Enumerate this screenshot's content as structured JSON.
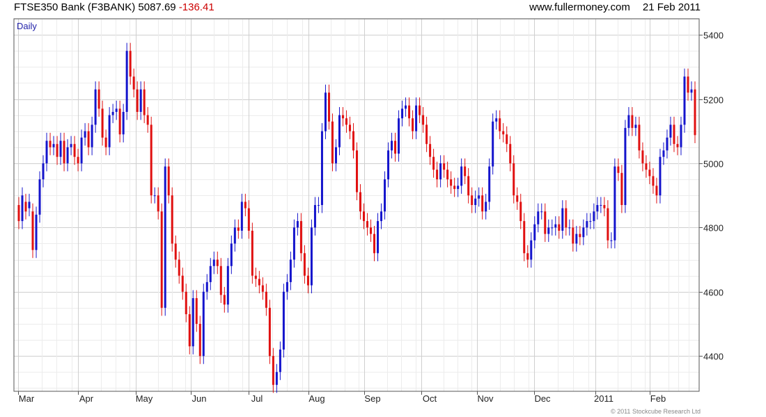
{
  "header": {
    "instrument": "FTSE350 Bank (F3BANK)",
    "last_price": "5087.69",
    "change": "-136.41",
    "source": "www.fullermoney.com",
    "date": "21 Feb 2011"
  },
  "footer": {
    "copyright": "© 2011 Stockcube Research Ltd"
  },
  "colors": {
    "up": "#1414cc",
    "down": "#e01010",
    "change": "#cc0000",
    "grid": "#d4d4d4",
    "label_blue": "#2222aa"
  },
  "chart_data": {
    "type": "ohlc",
    "period_label": "Daily",
    "x_tick_labels": [
      "Mar",
      "Apr",
      "May",
      "Jun",
      "Jul",
      "Aug",
      "Sep",
      "Oct",
      "Nov",
      "Dec",
      "2011",
      "Feb"
    ],
    "y_tick_labels": [
      "4400",
      "4600",
      "4800",
      "5000",
      "5200",
      "5400"
    ],
    "ylim": [
      4290,
      5450
    ],
    "grid": true,
    "series": [
      {
        "values": [
          4820,
          4900,
          4850,
          4880,
          4730,
          4840,
          4950,
          5000,
          5070,
          5050,
          5060,
          5020,
          5070,
          5000,
          5050,
          5060,
          5020,
          5000,
          5080,
          5100,
          5050,
          5120,
          5230,
          5170,
          5080,
          5050,
          5150,
          5160,
          5170,
          5090,
          5160,
          5350,
          5270,
          5230,
          5160,
          5230,
          5150,
          5120,
          4900,
          4900,
          4850,
          4550,
          4990,
          4900,
          4750,
          4700,
          4650,
          4600,
          4530,
          4430,
          4580,
          4500,
          4400,
          4600,
          4630,
          4680,
          4700,
          4680,
          4590,
          4560,
          4680,
          4750,
          4800,
          4790,
          4880,
          4860,
          4790,
          4650,
          4640,
          4620,
          4600,
          4550,
          4400,
          4310,
          4350,
          4420,
          4600,
          4630,
          4700,
          4800,
          4820,
          4720,
          4650,
          4620,
          4800,
          4870,
          4870,
          5100,
          5220,
          5130,
          5000,
          5050,
          5150,
          5140,
          5120,
          5100,
          5040,
          4910,
          4850,
          4820,
          4800,
          4780,
          4720,
          4820,
          4850,
          4950,
          5040,
          5070,
          5030,
          5140,
          5170,
          5180,
          5140,
          5100,
          5180,
          5150,
          5120,
          5060,
          5020,
          4980,
          4950,
          5000,
          4980,
          4950,
          4930,
          4920,
          4930,
          4990,
          4960,
          4900,
          4870,
          4890,
          4900,
          4850,
          4880,
          4990,
          5130,
          5140,
          5100,
          5090,
          5060,
          5000,
          4900,
          4880,
          4820,
          4720,
          4700,
          4760,
          4810,
          4850,
          4850,
          4780,
          4800,
          4800,
          4810,
          4790,
          4860,
          4800,
          4800,
          4750,
          4780,
          4770,
          4800,
          4820,
          4820,
          4850,
          4870,
          4870,
          4860,
          4760,
          4760,
          4990,
          4970,
          4870,
          5110,
          5150,
          5110,
          5120,
          5040,
          5000,
          4980,
          4960,
          4930,
          4900,
          5020,
          5040,
          5080,
          5120,
          5060,
          5050,
          5120,
          5270,
          5220,
          5230,
          5087.69
        ]
      },
      {
        "values": [
          4870,
          4820,
          4880,
          4860,
          4850,
          4730,
          4840,
          4950,
          5000,
          5070,
          5050,
          5060,
          5020,
          5070,
          5000,
          5050,
          5060,
          5020,
          5000,
          5080,
          5100,
          5050,
          5120,
          5230,
          5170,
          5080,
          5050,
          5150,
          5160,
          5170,
          5090,
          5160,
          5350,
          5270,
          5230,
          5160,
          5230,
          5150,
          5120,
          4900,
          4900,
          4850,
          4550,
          4990,
          4900,
          4750,
          4700,
          4650,
          4600,
          4530,
          4430,
          4580,
          4500,
          4400,
          4600,
          4630,
          4680,
          4700,
          4680,
          4590,
          4560,
          4680,
          4750,
          4800,
          4790,
          4880,
          4860,
          4790,
          4650,
          4640,
          4620,
          4600,
          4550,
          4400,
          4310,
          4350,
          4420,
          4600,
          4630,
          4700,
          4800,
          4820,
          4720,
          4650,
          4620,
          4800,
          4870,
          4870,
          5100,
          5220,
          5130,
          5000,
          5050,
          5150,
          5140,
          5120,
          5100,
          5040,
          4910,
          4850,
          4820,
          4800,
          4780,
          4720,
          4820,
          4850,
          4950,
          5040,
          5070,
          5030,
          5140,
          5170,
          5180,
          5140,
          5100,
          5180,
          5150,
          5120,
          5060,
          5020,
          4980,
          4950,
          5000,
          4980,
          4950,
          4930,
          4920,
          4930,
          4990,
          4960,
          4900,
          4870,
          4890,
          4900,
          4850,
          4880,
          4990,
          5130,
          5140,
          5100,
          5090,
          5060,
          5000,
          4900,
          4880,
          4820,
          4720,
          4700,
          4760,
          4810,
          4850,
          4850,
          4780,
          4800,
          4800,
          4810,
          4790,
          4860,
          4800,
          4800,
          4750,
          4780,
          4770,
          4800,
          4820,
          4820,
          4850,
          4870,
          4870,
          4860,
          4760,
          4760,
          4990,
          4970,
          4870,
          5110,
          5150,
          5110,
          5120,
          5040,
          5000,
          4980,
          4960,
          4930,
          4900,
          5020,
          5040,
          5080,
          5120,
          5060,
          5050,
          5120,
          5270,
          5220,
          5230
        ]
      }
    ]
  }
}
